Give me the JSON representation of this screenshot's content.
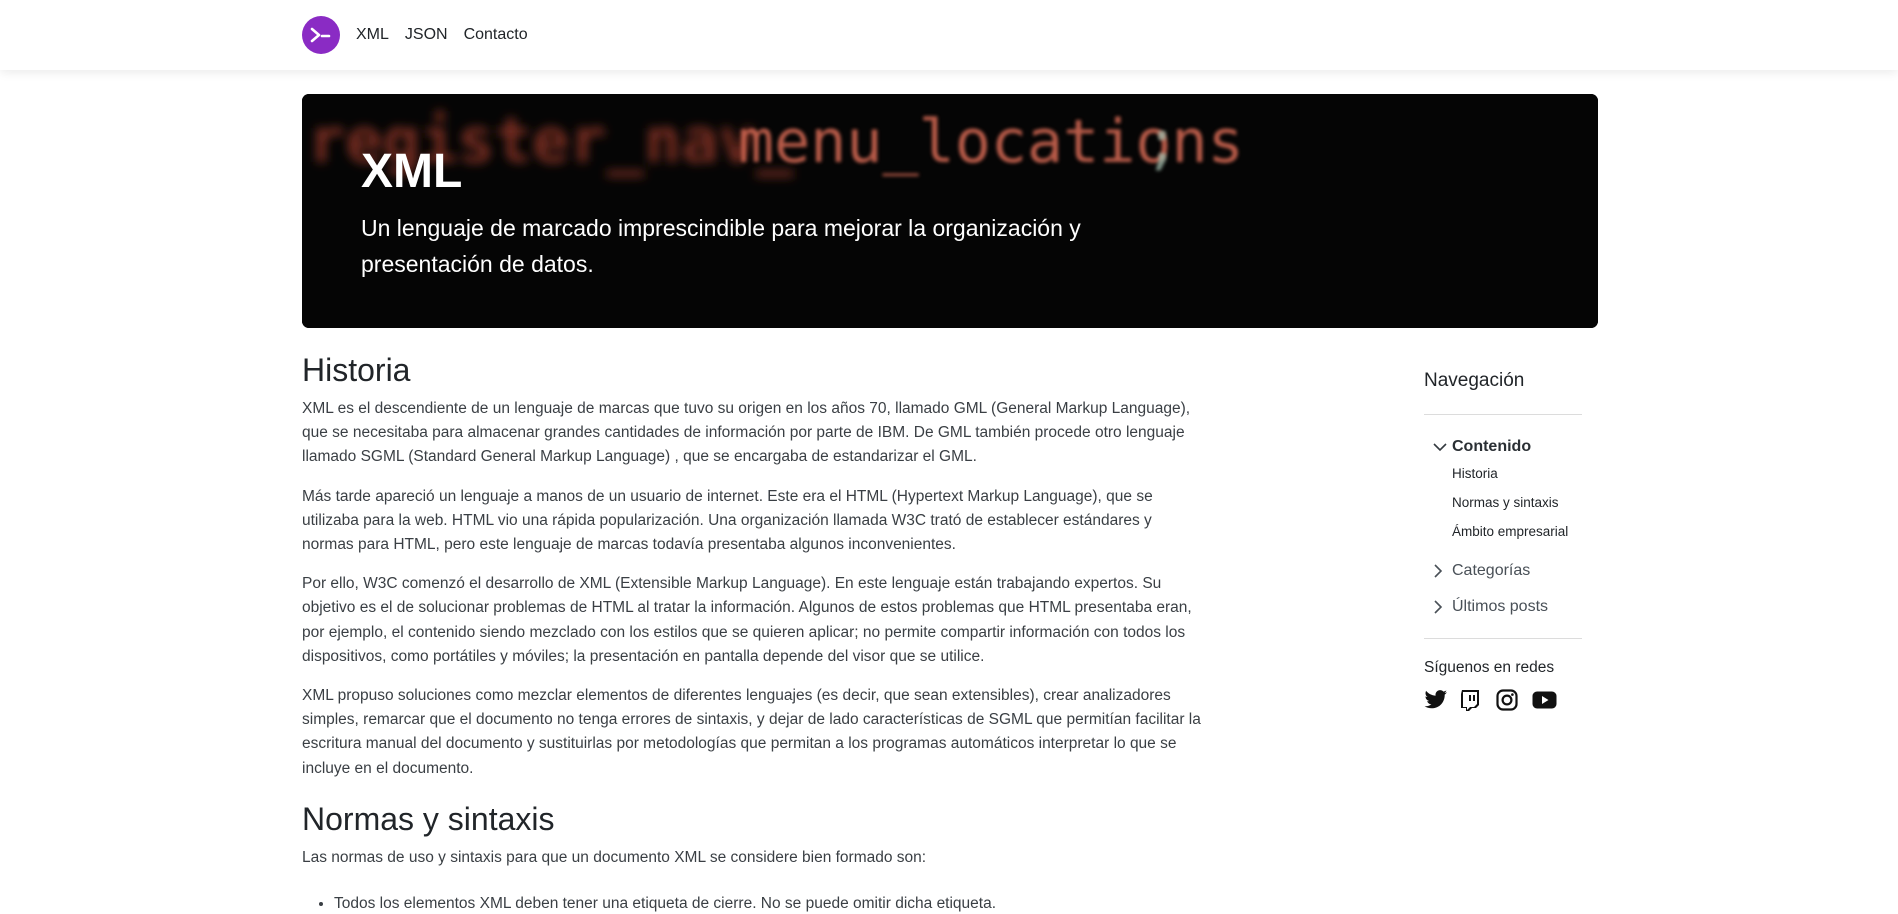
{
  "nav": {
    "logo_icon": "terminal-prompt-icon",
    "links": [
      "XML",
      "JSON",
      "Contacto"
    ]
  },
  "hero": {
    "background_text": "register_nav_menu_locations;",
    "title": "XML",
    "subtitle": "Un lenguaje de marcado imprescindible para mejorar la organización y presentación de datos."
  },
  "article": {
    "sections": [
      {
        "heading": "Historia",
        "paragraphs": [
          "XML es el descendiente de un lenguaje de marcas que tuvo su origen en los años 70, llamado GML (General Markup Language), que se necesitaba para almacenar grandes cantidades de información por parte de IBM. De GML también procede otro lenguaje llamado SGML (Standard General Markup Language) , que se encargaba de estandarizar el GML.",
          "Más tarde apareció un lenguaje a manos de un usuario de internet. Este era el HTML (Hypertext Markup Language), que se utilizaba para la web. HTML vio una rápida popularización. Una organización llamada W3C trató de establecer estándares y normas para HTML, pero este lenguaje de marcas todavía presentaba algunos inconvenientes.",
          "Por ello, W3C comenzó el desarrollo de XML (Extensible Markup Language). En este lenguaje están trabajando expertos. Su objetivo es el de solucionar problemas de HTML al tratar la información. Algunos de estos problemas que HTML presentaba eran, por ejemplo, el contenido siendo mezclado con los estilos que se quieren aplicar; no permite compartir información con todos los dispositivos, como portátiles y móviles; la presentación en pantalla depende del visor que se utilice.",
          "XML propuso soluciones como mezclar elementos de diferentes lenguajes (es decir, que sean extensibles), crear analizadores simples, remarcar que el documento no tenga errores de sintaxis, y dejar de lado características de SGML que permitían facilitar la escritura manual del documento y sustituirlas por metodologías que permitan a los programas automáticos interpretar lo que se incluye en el documento."
        ]
      },
      {
        "heading": "Normas y sintaxis",
        "paragraphs": [
          "Las normas de uso y sintaxis para que un documento XML se considere bien formado son:"
        ],
        "list": [
          "Todos los elementos XML deben tener una etiqueta de cierre. No se puede omitir dicha etiqueta."
        ]
      }
    ]
  },
  "sidebar": {
    "title": "Navegación",
    "groups": [
      {
        "label": "Contenido",
        "expanded": true,
        "icon": "chevron-down-icon",
        "items": [
          "Historia",
          "Normas y sintaxis",
          "Ámbito empresarial"
        ]
      },
      {
        "label": "Categorías",
        "expanded": false,
        "icon": "chevron-right-icon"
      },
      {
        "label": "Últimos posts",
        "expanded": false,
        "icon": "chevron-right-icon"
      }
    ],
    "follow_label": "Síguenos en redes",
    "social_icons": [
      "twitter-icon",
      "twitch-icon",
      "instagram-icon",
      "youtube-icon"
    ]
  },
  "colors": {
    "brand": "#8a2bc4",
    "hero_background": "#050505",
    "hero_code_text": "#d86a55"
  }
}
